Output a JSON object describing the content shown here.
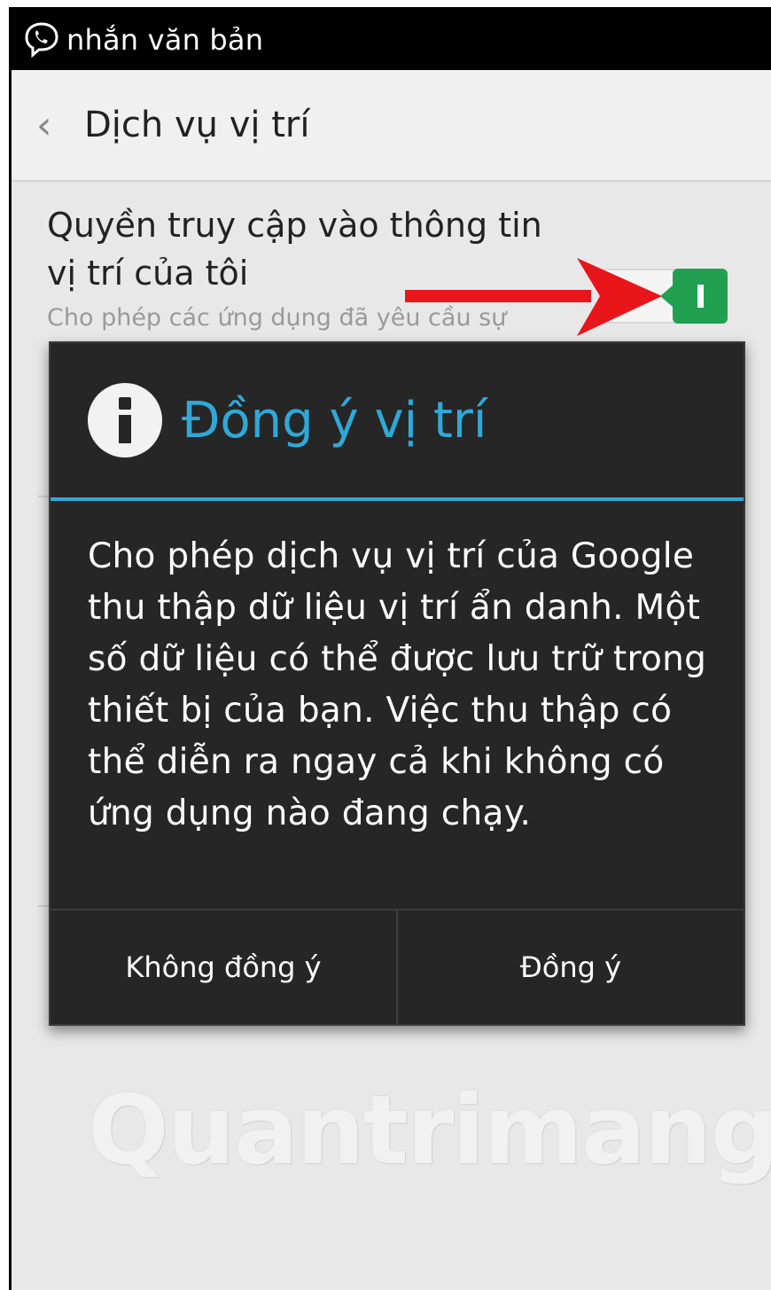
{
  "status_bar": {
    "app_icon": "viber-icon",
    "text": "nhắn văn bản"
  },
  "app_bar": {
    "back_icon": "chevron-left-icon",
    "title": "Dịch vụ vị trí"
  },
  "setting": {
    "title": "Quyền truy cập vào thông tin vị trí của tôi",
    "subtitle": "Cho phép các ứng dụng đã yêu cầu sự",
    "toggle_on": true,
    "toggle_color": "#22a052"
  },
  "annotation": {
    "arrow_color": "#e8161b"
  },
  "dialog": {
    "icon": "info-icon",
    "title": "Đồng ý vị trí",
    "title_color": "#2fa8d8",
    "body": "Cho phép dịch vụ vị trí của Google thu thập dữ liệu vị trí ẩn danh. Một số dữ liệu có thể được lưu trữ trong thiết bị của bạn. Việc thu thập có thể diễn ra ngay cả khi không có ứng dụng nào đang chạy.",
    "buttons": {
      "decline": "Không đồng ý",
      "accept": "Đồng ý"
    }
  },
  "watermark": {
    "text": "Quantrimang",
    "icon": "lightbulb-icon"
  }
}
